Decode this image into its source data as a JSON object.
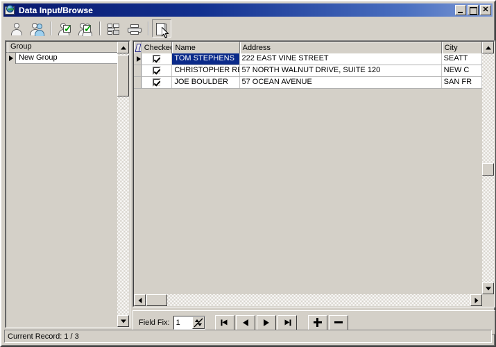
{
  "window": {
    "title": "Data Input/Browse",
    "icon": "app-globe-icon",
    "min_label": "",
    "max_label": "",
    "close_label": "✕"
  },
  "toolbar": {
    "buttons": [
      {
        "name": "add-person",
        "icon": "person-icon",
        "pressed": false
      },
      {
        "name": "find-person",
        "icon": "person-search-icon",
        "pressed": false
      },
      {
        "name": "check-person",
        "icon": "person-check-icon",
        "pressed": false
      },
      {
        "name": "check-all-persons",
        "icon": "persons-check-icon",
        "pressed": false
      },
      {
        "name": "grid-layout",
        "icon": "grid-icon",
        "pressed": false
      },
      {
        "name": "print",
        "icon": "printer-icon",
        "pressed": false
      },
      {
        "name": "exit",
        "icon": "exit-door-icon",
        "pressed": true
      }
    ]
  },
  "group_panel": {
    "header": "Group",
    "rows": [
      {
        "label": "New Group",
        "current": true
      }
    ]
  },
  "grid": {
    "columns": [
      {
        "key": "indicator",
        "label": ""
      },
      {
        "key": "checked",
        "label": "Checked"
      },
      {
        "key": "name",
        "label": "Name"
      },
      {
        "key": "address",
        "label": "Address"
      },
      {
        "key": "city",
        "label": "City"
      }
    ],
    "rows": [
      {
        "current": true,
        "checked": true,
        "name": "TOM STEPHENS",
        "name_selected": true,
        "address": "222 EAST VINE STREET",
        "city": "SEATT"
      },
      {
        "current": false,
        "checked": true,
        "name": "CHRISTOPHER RE",
        "name_selected": false,
        "address": "57 NORTH WALNUT DRIVE, SUITE 120",
        "city": "NEW C"
      },
      {
        "current": false,
        "checked": true,
        "name": "JOE BOULDER",
        "name_selected": false,
        "address": "57 OCEAN AVENUE",
        "city": "SAN FR"
      }
    ]
  },
  "navbar": {
    "field_fix_label": "Field Fix:",
    "field_fix_value": "1",
    "buttons": [
      {
        "name": "first-record",
        "label": ""
      },
      {
        "name": "previous-record",
        "label": ""
      },
      {
        "name": "next-record",
        "label": ""
      },
      {
        "name": "last-record",
        "label": ""
      },
      {
        "name": "add-record",
        "label": ""
      },
      {
        "name": "delete-record",
        "label": ""
      }
    ]
  },
  "statusbar": {
    "text": "Current Record: 1 / 3"
  },
  "colors": {
    "face": "#d4d0c8",
    "selection": "#0a2a8a",
    "title_start": "#0a1a6e",
    "title_end": "#7e9ad6",
    "check_green": "#00a000"
  }
}
